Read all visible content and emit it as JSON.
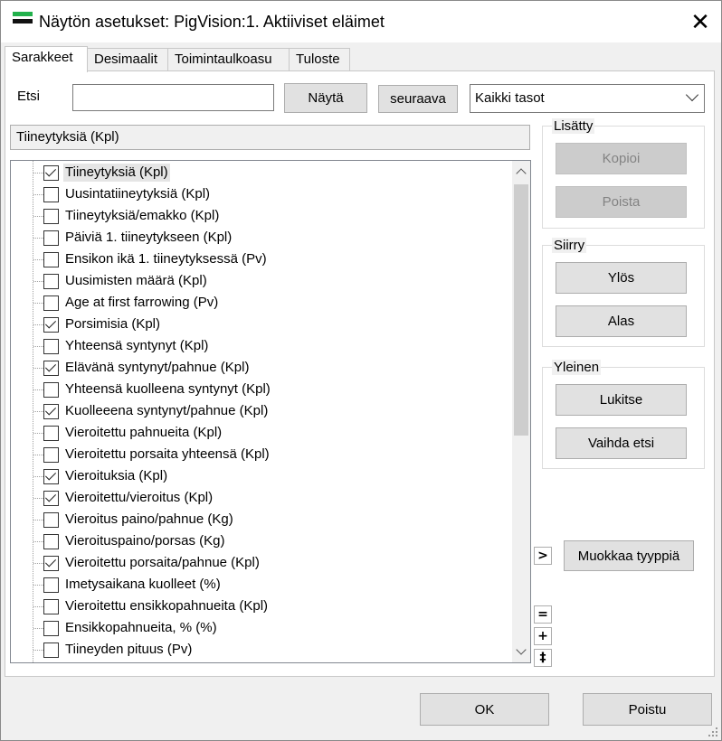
{
  "window": {
    "title": "Näytön asetukset: PigVision:1. Aktiiviset eläimet",
    "close_label": "✕"
  },
  "tabs": [
    {
      "label": "Sarakkeet",
      "active": true
    },
    {
      "label": "Desimaalit",
      "active": false
    },
    {
      "label": "Toimintaulkoasu",
      "active": false
    },
    {
      "label": "Tuloste",
      "active": false
    }
  ],
  "search": {
    "label": "Etsi",
    "value": "",
    "show_button": "Näytä",
    "next_button": "seuraava",
    "level_select": "Kaikki tasot"
  },
  "selected_item": "Tiineytyksiä (Kpl)",
  "groups": {
    "added": {
      "title": "Lisätty",
      "copy_button": "Kopioi",
      "delete_button": "Poista"
    },
    "move": {
      "title": "Siirry",
      "up_button": "Ylös",
      "down_button": "Alas"
    },
    "general": {
      "title": "Yleinen",
      "lock_button": "Lukitse",
      "change_search_button": "Vaihda etsi"
    }
  },
  "expand_button": ">",
  "edit_type_button": "Muokkaa tyyppiä",
  "small_buttons": [
    "=",
    "+",
    "‡"
  ],
  "items": [
    {
      "label": "Tiineytyksiä (Kpl)",
      "checked": true,
      "selected": true
    },
    {
      "label": "Uusintatiineytyksiä (Kpl)",
      "checked": false
    },
    {
      "label": "Tiineytyksiä/emakko (Kpl)",
      "checked": false
    },
    {
      "label": "Päiviä 1. tiineytykseen (Kpl)",
      "checked": false
    },
    {
      "label": "Ensikon ikä 1. tiineytyksessä (Pv)",
      "checked": false
    },
    {
      "label": "Uusimisten määrä (Kpl)",
      "checked": false
    },
    {
      "label": "Age at first farrowing (Pv)",
      "checked": false
    },
    {
      "label": "Porsimisia (Kpl)",
      "checked": true
    },
    {
      "label": "Yhteensä syntynyt (Kpl)",
      "checked": false
    },
    {
      "label": "Elävänä syntynyt/pahnue (Kpl)",
      "checked": true
    },
    {
      "label": "Yhteensä kuolleena syntynyt (Kpl)",
      "checked": false
    },
    {
      "label": "Kuolleeena syntynyt/pahnue (Kpl)",
      "checked": true
    },
    {
      "label": "Vieroitettu pahnueita (Kpl)",
      "checked": false
    },
    {
      "label": "Vieroitettu porsaita yhteensä (Kpl)",
      "checked": false
    },
    {
      "label": "Vieroituksia (Kpl)",
      "checked": true
    },
    {
      "label": "Vieroitettu/vieroitus (Kpl)",
      "checked": true
    },
    {
      "label": "Vieroitus paino/pahnue (Kg)",
      "checked": false
    },
    {
      "label": "Vieroituspaino/porsas (Kg)",
      "checked": false
    },
    {
      "label": "Vieroitettu porsaita/pahnue (Kpl)",
      "checked": true
    },
    {
      "label": "Imetysaikana kuolleet (%)",
      "checked": false
    },
    {
      "label": "Vieroitettu ensikkopahnueita (Kpl)",
      "checked": false
    },
    {
      "label": "Ensikkopahnueita, % (%)",
      "checked": false
    },
    {
      "label": "Tiineyden pituus (Pv)",
      "checked": false
    }
  ],
  "footer": {
    "ok_button": "OK",
    "cancel_button": "Poistu"
  }
}
